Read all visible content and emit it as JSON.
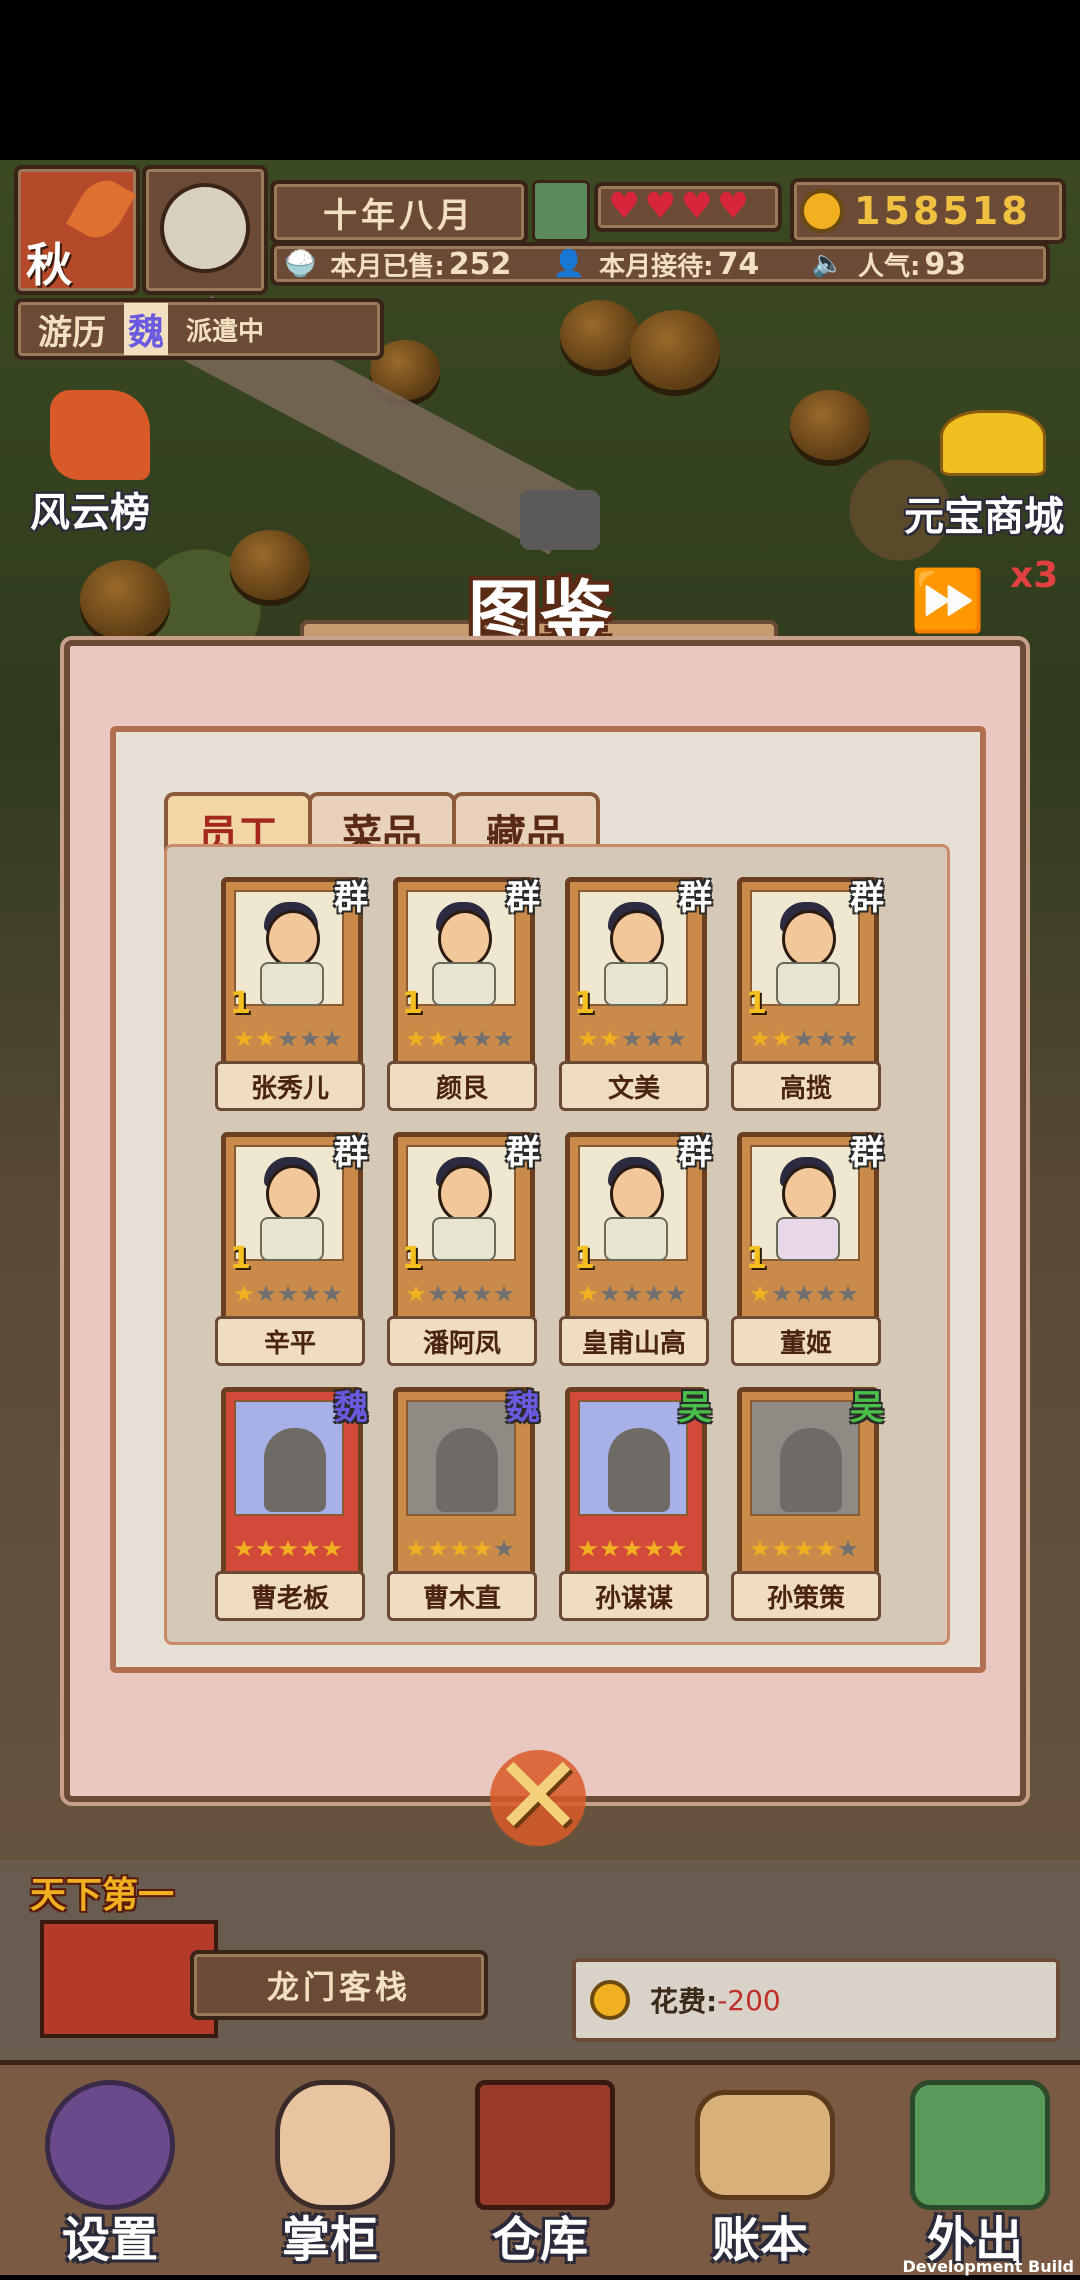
{
  "hud": {
    "season": "秋",
    "date": "十年八月",
    "coins": "158518",
    "sold_label": "本月已售:",
    "sold_value": "252",
    "served_label": "本月接待:",
    "served_value": "74",
    "popularity_label": "人气:",
    "popularity_value": "93",
    "hearts": 4
  },
  "travel": {
    "label": "游历",
    "kingdom": "魏",
    "status": "派遣中"
  },
  "side_buttons": {
    "ranking": "风云榜",
    "shop": "元宝商城",
    "speed": "x3"
  },
  "dialog": {
    "title": "图鉴",
    "tabs": [
      "员工",
      "菜品",
      "藏品"
    ],
    "active_tab": 0,
    "cards": [
      {
        "name": "张秀儿",
        "badge": "群",
        "level": "1",
        "stars": 2,
        "locked": false
      },
      {
        "name": "颜艮",
        "badge": "群",
        "level": "1",
        "stars": 2,
        "locked": false
      },
      {
        "name": "文美",
        "badge": "群",
        "level": "1",
        "stars": 2,
        "locked": false
      },
      {
        "name": "高揽",
        "badge": "群",
        "level": "1",
        "stars": 2,
        "locked": false
      },
      {
        "name": "辛平",
        "badge": "群",
        "level": "1",
        "stars": 1,
        "locked": false
      },
      {
        "name": "潘阿凤",
        "badge": "群",
        "level": "1",
        "stars": 1,
        "locked": false
      },
      {
        "name": "皇甫山高",
        "badge": "群",
        "level": "1",
        "stars": 1,
        "locked": false
      },
      {
        "name": "董姬",
        "badge": "群",
        "level": "1",
        "stars": 1,
        "locked": false,
        "female": true
      },
      {
        "name": "曹老板",
        "badge": "魏",
        "level": "",
        "stars": 5,
        "locked": true,
        "rare": true
      },
      {
        "name": "曹木直",
        "badge": "魏",
        "level": "",
        "stars": 4,
        "locked": true,
        "rare": false
      },
      {
        "name": "孙谋谋",
        "badge": "吴",
        "level": "",
        "stars": 5,
        "locked": true,
        "rare": true
      },
      {
        "name": "孙策策",
        "badge": "吴",
        "level": "",
        "stars": 4,
        "locked": true,
        "rare": false
      }
    ]
  },
  "bottom": {
    "inn_name": "龙门客栈",
    "sign": "天下第一",
    "cost_label": "花费:",
    "cost_value": "-200",
    "nav": [
      "设置",
      "掌柜",
      "仓库",
      "账本",
      "外出"
    ]
  },
  "watermark": "Development Build",
  "colors": {
    "accent": "#a4281c",
    "wei": "#6a5ae0",
    "wu": "#4ac04a",
    "gold": "#f0b020"
  }
}
